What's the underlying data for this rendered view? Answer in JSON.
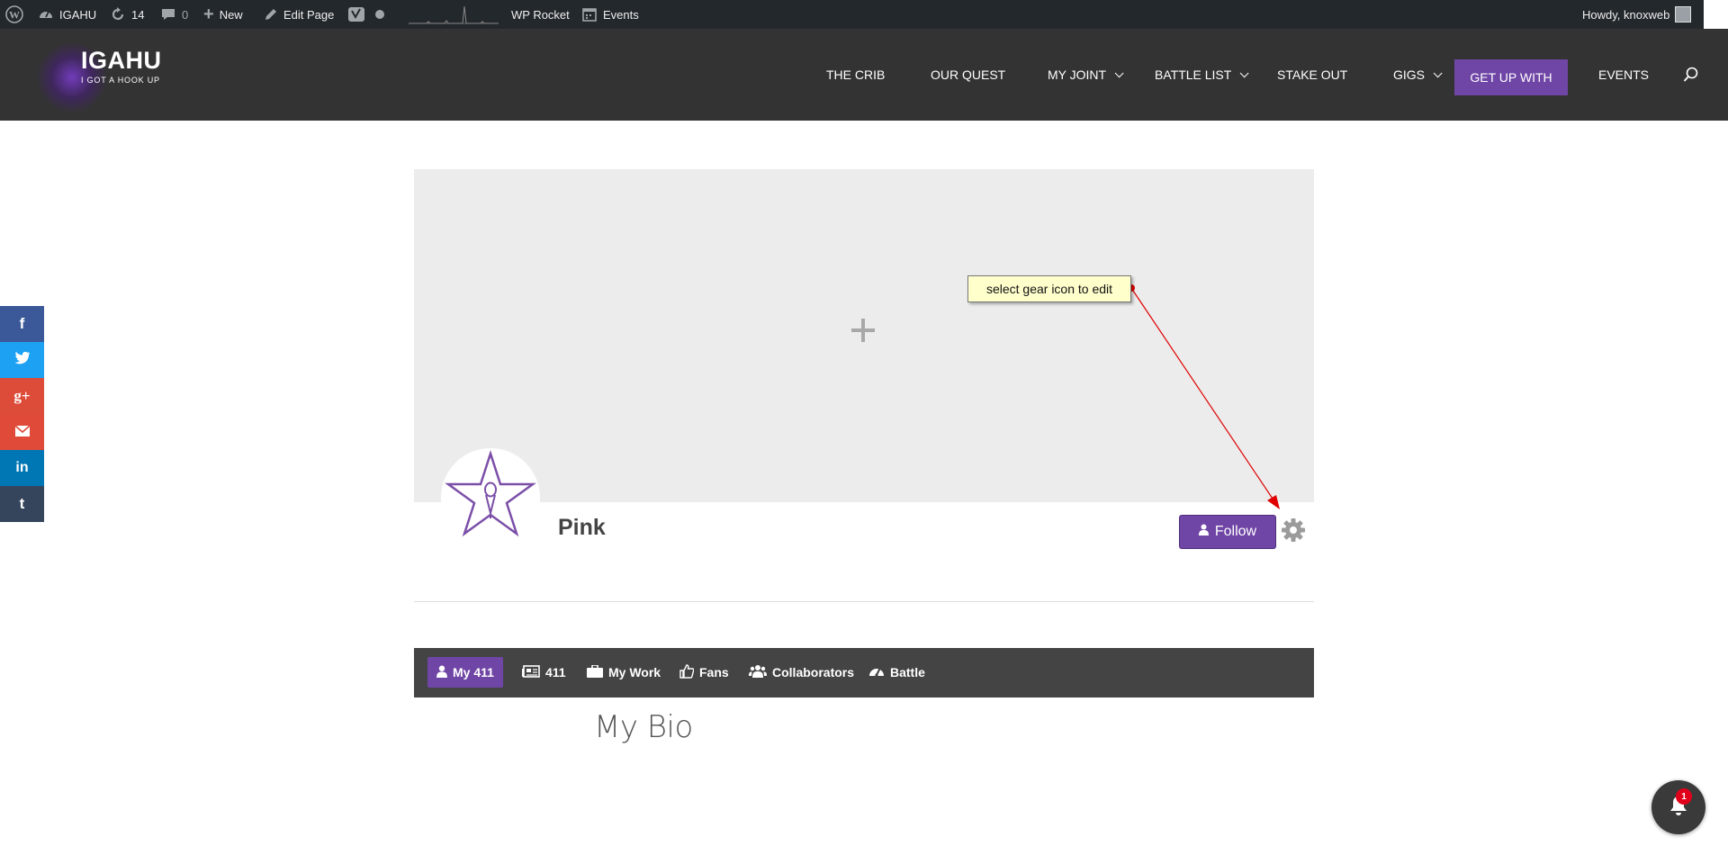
{
  "adminbar": {
    "site_name": "IGAHU",
    "updates_count": "14",
    "comments_count": "0",
    "new_label": "New",
    "edit_page_label": "Edit Page",
    "wp_rocket_label": "WP Rocket",
    "events_label": "Events",
    "howdy_label": "Howdy, knoxweb"
  },
  "logo": {
    "title": "IGAHU",
    "tagline": "I GOT A HOOK UP"
  },
  "nav": {
    "items": [
      {
        "label": "THE CRIB",
        "has_dropdown": false
      },
      {
        "label": "OUR QUEST",
        "has_dropdown": false
      },
      {
        "label": "MY JOINT",
        "has_dropdown": true
      },
      {
        "label": "BATTLE LIST",
        "has_dropdown": true
      },
      {
        "label": "STAKE OUT",
        "has_dropdown": false
      },
      {
        "label": "GIGS",
        "has_dropdown": true
      }
    ],
    "cta_label": "GET UP WITH",
    "events_label": "EVENTS"
  },
  "share": [
    {
      "icon": "facebook-icon",
      "glyph": "f",
      "color": "#3b5998"
    },
    {
      "icon": "twitter-icon",
      "glyph": "t",
      "color": "#1da1f2"
    },
    {
      "icon": "google-plus-icon",
      "glyph": "g+",
      "color": "#dd4b39"
    },
    {
      "icon": "email-icon",
      "glyph": "✉",
      "color": "#e04a39"
    },
    {
      "icon": "linkedin-icon",
      "glyph": "in",
      "color": "#0077b5"
    },
    {
      "icon": "tumblr-icon",
      "glyph": "t",
      "color": "#35465c"
    }
  ],
  "profile": {
    "name": "Pink",
    "follow_label": "Follow",
    "tooltip": "select gear icon to edit"
  },
  "tabs": [
    {
      "label": "My 411",
      "icon": "user-icon",
      "active": true
    },
    {
      "label": "411",
      "icon": "newspaper-icon",
      "active": false
    },
    {
      "label": "My Work",
      "icon": "briefcase-icon",
      "active": false
    },
    {
      "label": "Fans",
      "icon": "thumbs-up-icon",
      "active": false
    },
    {
      "label": "Collaborators",
      "icon": "users-icon",
      "active": false
    },
    {
      "label": "Battle",
      "icon": "dashboard-icon",
      "active": false
    }
  ],
  "bio": {
    "title": "My Bio"
  },
  "notifications": {
    "count": "1"
  },
  "colors": {
    "accent": "#6f45a6",
    "adminbar": "#23282d",
    "header": "#333333"
  }
}
